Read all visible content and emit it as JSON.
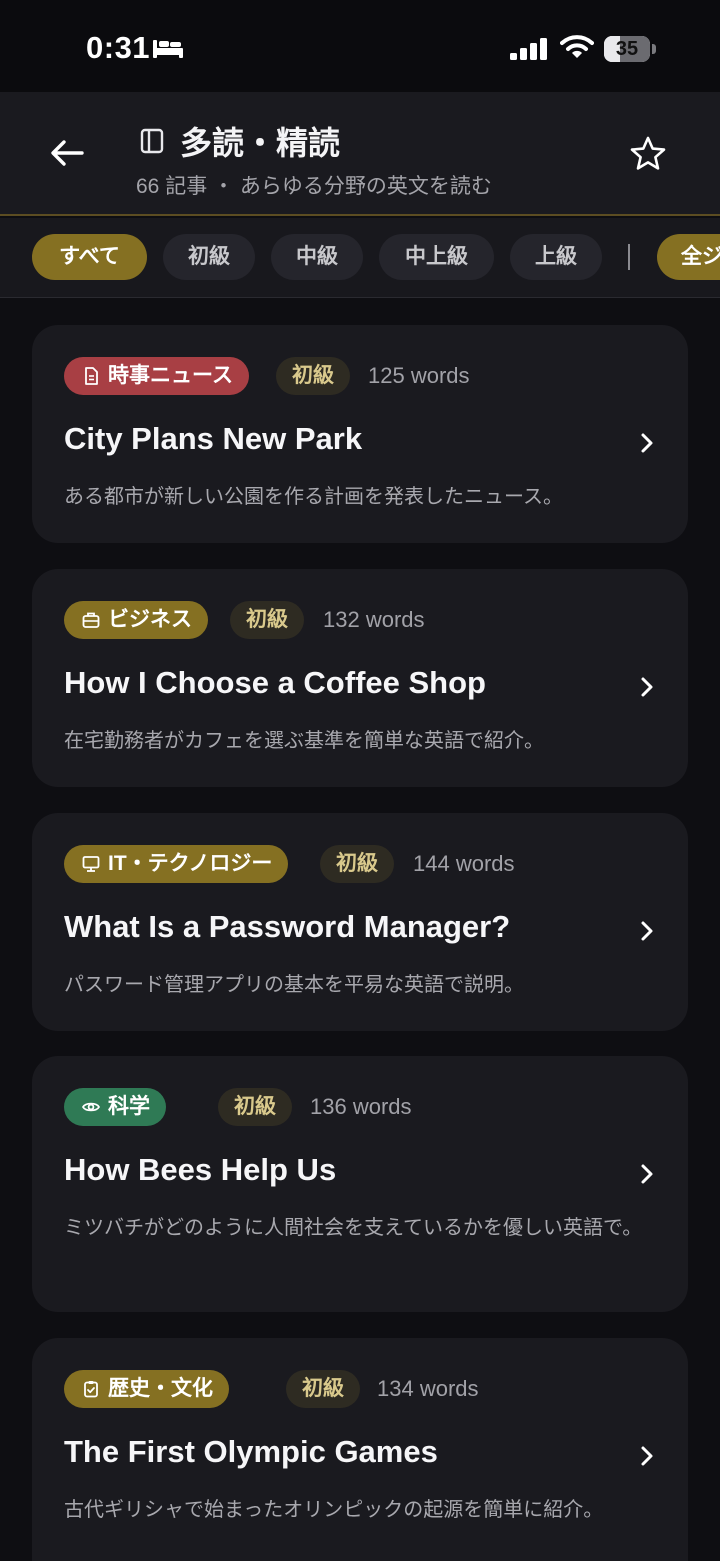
{
  "status_bar": {
    "time": "0:31",
    "battery": "35",
    "battery_level_percent": 35,
    "icons": [
      "bed-icon",
      "signal-icon",
      "wifi-icon",
      "battery-icon"
    ]
  },
  "header": {
    "title": "多読・精読",
    "subtitle": "66 記事 ・ あらゆる分野の英文を読む",
    "icons": [
      "back-arrow-icon",
      "book-icon",
      "star-icon"
    ]
  },
  "filters": {
    "chips": [
      "すべて",
      "初級",
      "中級",
      "中上級",
      "上級"
    ],
    "active": "すべて",
    "extra_chip": "全ジ"
  },
  "colors": {
    "accent": "#857022",
    "news": "#a83f44",
    "business": "#857022",
    "it": "#857022",
    "science": "#2f7a55",
    "history": "#857022"
  },
  "articles": [
    {
      "category": "時事ニュース",
      "category_icon": "document-icon",
      "level": "初級",
      "words": "125 words",
      "title": "City Plans New Park",
      "description": "ある都市が新しい公園を作る計画を発表したニュース。"
    },
    {
      "category": "ビジネス",
      "category_icon": "briefcase-icon",
      "level": "初級",
      "words": "132 words",
      "title": "How I Choose a Coffee Shop",
      "description": "在宅勤務者がカフェを選ぶ基準を簡単な英語で紹介。"
    },
    {
      "category": "IT・テクノロジー",
      "category_icon": "monitor-icon",
      "level": "初級",
      "words": "144 words",
      "title": "What Is a Password Manager?",
      "description": "パスワード管理アプリの基本を平易な英語で説明。"
    },
    {
      "category": "科学",
      "category_icon": "eye-icon",
      "level": "初級",
      "words": "136 words",
      "title": "How Bees Help Us",
      "description": "ミツバチがどのように人間社会を支えているかを優しい英語で。"
    },
    {
      "category": "歴史・文化",
      "category_icon": "clipboard-icon",
      "level": "初級",
      "words": "134 words",
      "title": "The First Olympic Games",
      "description": "古代ギリシャで始まったオリンピックの起源を簡単に紹介。"
    }
  ]
}
